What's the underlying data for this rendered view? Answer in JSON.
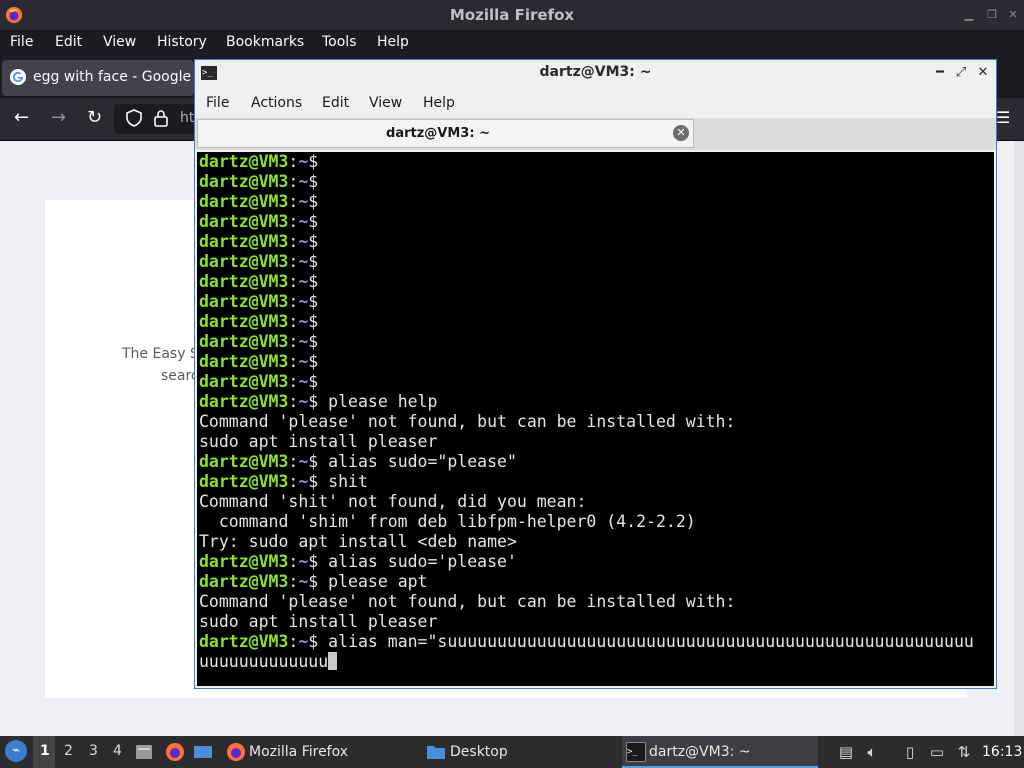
{
  "firefox": {
    "window_title": "Mozilla Firefox",
    "menu": [
      "File",
      "Edit",
      "View",
      "History",
      "Bookmarks",
      "Tools",
      "Help"
    ],
    "tab_title": "egg with face - Google S",
    "url_partial": "ht",
    "page_text_line1": "The Easy S",
    "page_text_line2": "searc"
  },
  "terminal": {
    "title": "dartz@VM3: ~",
    "menu": [
      "File",
      "Actions",
      "Edit",
      "View",
      "Help"
    ],
    "tab_label": "dartz@VM3: ~",
    "prompt_user": "dartz@VM3",
    "prompt_sep": ":",
    "prompt_path": "~",
    "prompt_symbol": "$",
    "lines": [
      {
        "prompt": true,
        "text": ""
      },
      {
        "prompt": true,
        "text": ""
      },
      {
        "prompt": true,
        "text": ""
      },
      {
        "prompt": true,
        "text": ""
      },
      {
        "prompt": true,
        "text": ""
      },
      {
        "prompt": true,
        "text": ""
      },
      {
        "prompt": true,
        "text": ""
      },
      {
        "prompt": true,
        "text": ""
      },
      {
        "prompt": true,
        "text": ""
      },
      {
        "prompt": true,
        "text": ""
      },
      {
        "prompt": true,
        "text": ""
      },
      {
        "prompt": true,
        "text": ""
      },
      {
        "prompt": true,
        "text": " please help"
      },
      {
        "prompt": false,
        "text": "Command 'please' not found, but can be installed with:"
      },
      {
        "prompt": false,
        "text": "sudo apt install pleaser"
      },
      {
        "prompt": true,
        "text": " alias sudo=\"please\""
      },
      {
        "prompt": true,
        "text": " shit"
      },
      {
        "prompt": false,
        "text": "Command 'shit' not found, did you mean:"
      },
      {
        "prompt": false,
        "text": "  command 'shim' from deb libfpm-helper0 (4.2-2.2)"
      },
      {
        "prompt": false,
        "text": "Try: sudo apt install <deb name>"
      },
      {
        "prompt": true,
        "text": " alias sudo='please'"
      },
      {
        "prompt": true,
        "text": " please apt"
      },
      {
        "prompt": false,
        "text": "Command 'please' not found, but can be installed with:"
      },
      {
        "prompt": false,
        "text": "sudo apt install pleaser"
      },
      {
        "prompt": true,
        "text": " alias man=\"suuuuuuuuuuuuuuuuuuuuuuuuuuuuuuuuuuuuuuuuuuuuuuuuuuuuu"
      },
      {
        "prompt": false,
        "text": "uuuuuuuuuuuuu",
        "cursor": true
      }
    ]
  },
  "taskbar": {
    "workspaces": [
      "1",
      "2",
      "3",
      "4"
    ],
    "active_workspace": "1",
    "tasks": [
      {
        "label": "Mozilla Firefox",
        "icon": "firefox-icon"
      },
      {
        "label": "Desktop",
        "icon": "folder-icon"
      },
      {
        "label": "dartz@VM3: ~",
        "icon": "terminal-icon",
        "active": true
      }
    ],
    "clock": "16:13"
  },
  "colors": {
    "prompt_user": "#8ae234",
    "prompt_path": "#729fcf",
    "terminal_bg": "#000000",
    "firefox_dark": "#1c1b22",
    "accent": "#3c7fd1"
  }
}
